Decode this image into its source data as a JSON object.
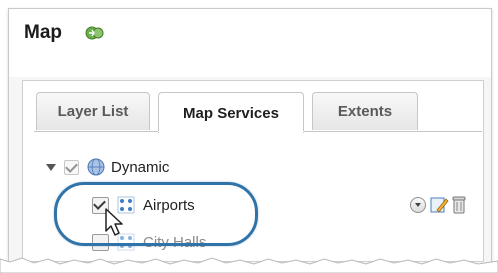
{
  "header": {
    "title": "Map",
    "title_icon": "sync-icon"
  },
  "tabs": [
    {
      "label": "Layer List",
      "active": false
    },
    {
      "label": "Map Services",
      "active": true
    },
    {
      "label": "Extents",
      "active": false
    }
  ],
  "tree": {
    "group": {
      "label": "Dynamic",
      "checked": true,
      "expanded": true,
      "icon": "globe-icon"
    },
    "layers": [
      {
        "label": "Airports",
        "checked": true,
        "icon": "layer-dots-icon",
        "highlighted": true
      },
      {
        "label": "City Halls",
        "checked": false,
        "icon": "layer-dots-icon"
      }
    ]
  },
  "actions": [
    "options-dropdown-icon",
    "edit-icon",
    "trash-icon"
  ],
  "colors": {
    "highlight_ring": "#2f73a8",
    "icon_blue": "#3a7fc7",
    "sync_green": "#4a9a33"
  }
}
